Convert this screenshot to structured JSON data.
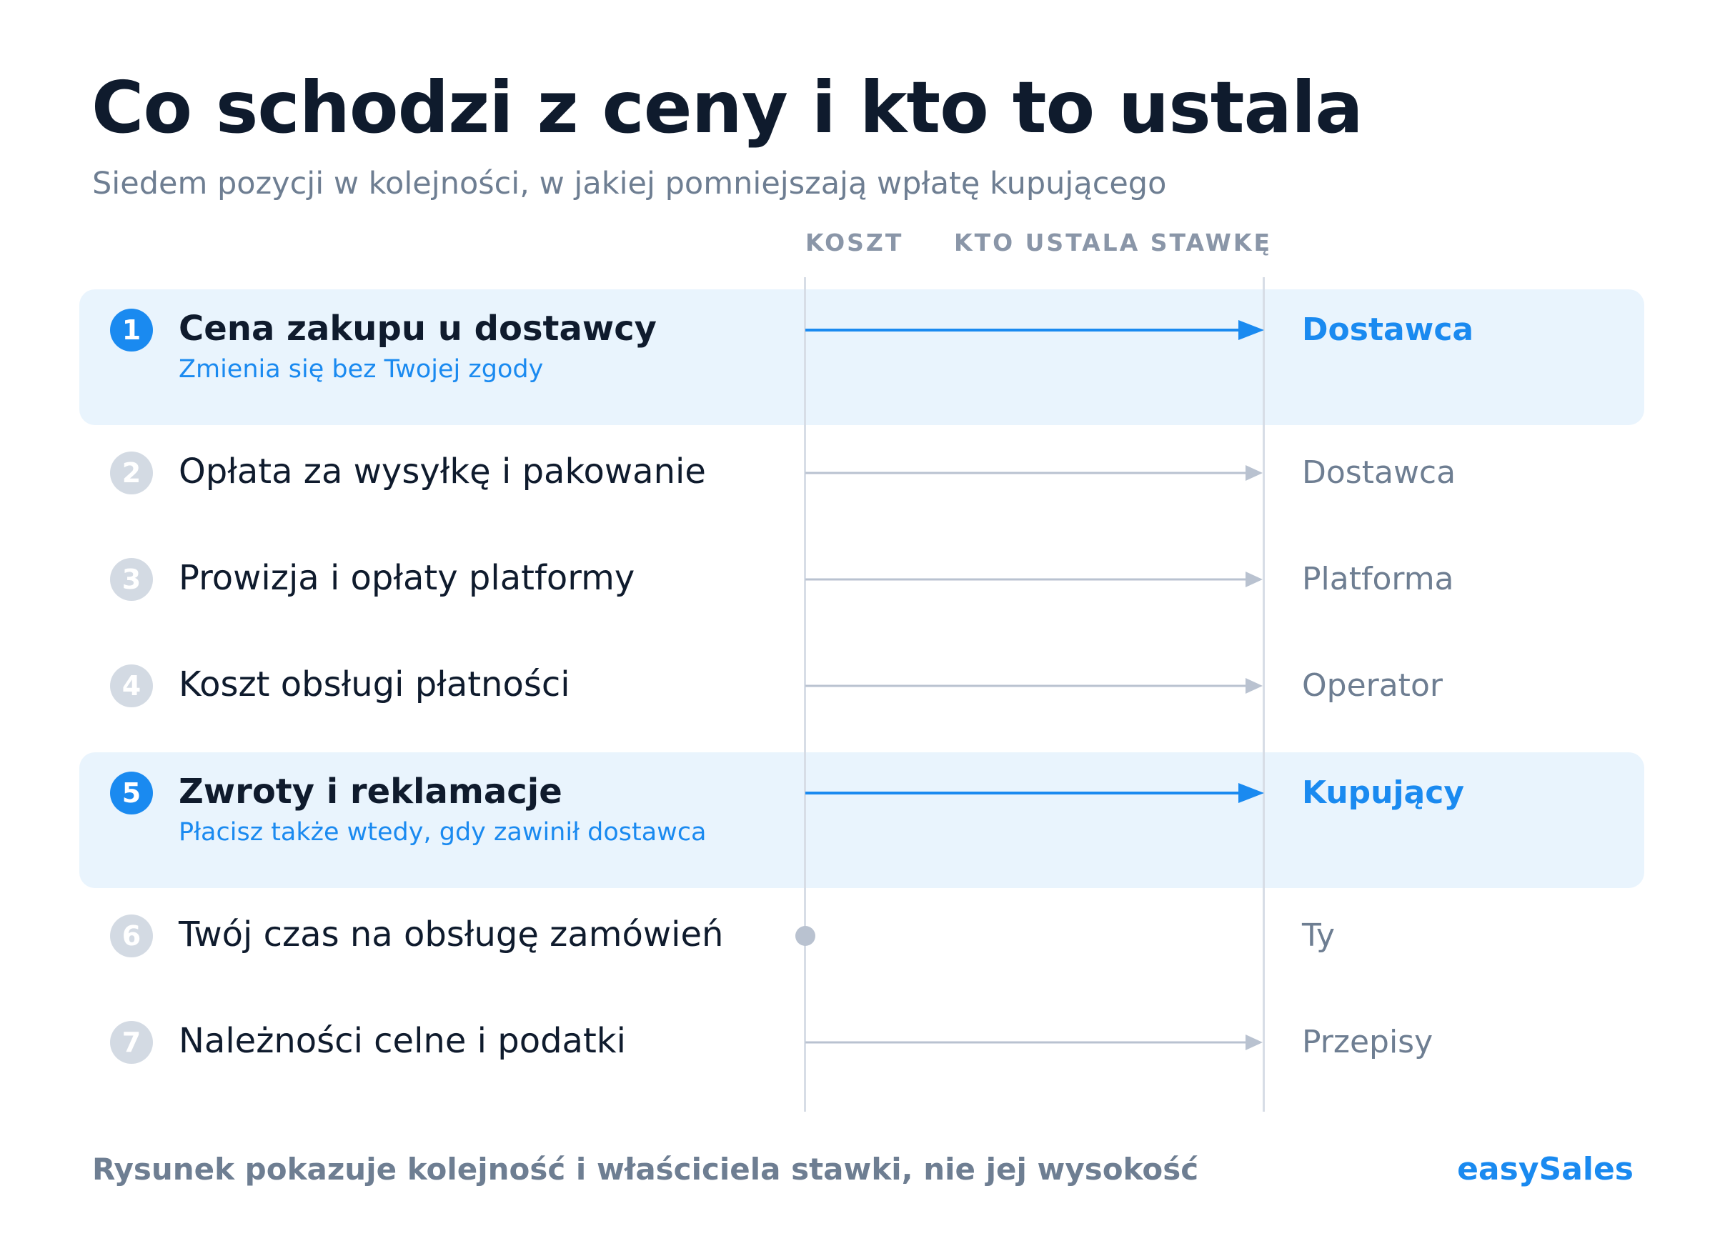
{
  "title": "Co schodzi z ceny i kto to ustala",
  "subtitle": "Siedem pozycji w kolejności, w jakiej pomniejszają wpłatę kupującego",
  "columns": {
    "cost": "KOSZT",
    "owner": "KTO USTALA STAWKĘ"
  },
  "colors": {
    "accent": "#1a8af0",
    "muted": "#6e7e92",
    "line": "#b9c2d0",
    "band": "#e9f4fd"
  },
  "rows": [
    {
      "number": "1",
      "label": "Cena zakupu u dostawcy",
      "note": "Zmienia się bez Twojej zgody",
      "owner": "Dostawca",
      "highlighted": true,
      "connector": "arrow"
    },
    {
      "number": "2",
      "label": "Opłata za wysyłkę i pakowanie",
      "note": "",
      "owner": "Dostawca",
      "highlighted": false,
      "connector": "arrow"
    },
    {
      "number": "3",
      "label": "Prowizja i opłaty platformy",
      "note": "",
      "owner": "Platforma",
      "highlighted": false,
      "connector": "arrow"
    },
    {
      "number": "4",
      "label": "Koszt obsługi płatności",
      "note": "",
      "owner": "Operator",
      "highlighted": false,
      "connector": "arrow"
    },
    {
      "number": "5",
      "label": "Zwroty i reklamacje",
      "note": "Płacisz także wtedy, gdy zawinił dostawca",
      "owner": "Kupujący",
      "highlighted": true,
      "connector": "arrow"
    },
    {
      "number": "6",
      "label": "Twój czas na obsługę zamówień",
      "note": "",
      "owner": "Ty",
      "highlighted": false,
      "connector": "dot"
    },
    {
      "number": "7",
      "label": "Należności celne i podatki",
      "note": "",
      "owner": "Przepisy",
      "highlighted": false,
      "connector": "arrow"
    }
  ],
  "footer": {
    "note": "Rysunek pokazuje kolejność i właściciela stawki, nie jej wysokość",
    "brand": "easySales"
  }
}
